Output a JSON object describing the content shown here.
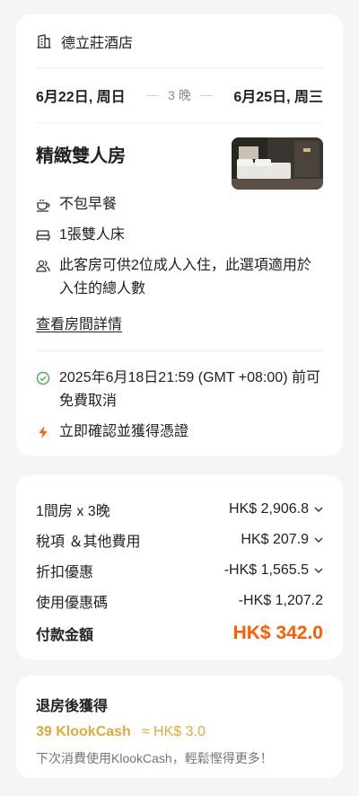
{
  "hotel": {
    "name": "德立莊酒店",
    "icon": "hotel-building-icon"
  },
  "stay": {
    "checkin": "6月22日, 周日",
    "nights": "3 晚",
    "checkout": "6月25日, 周三"
  },
  "room": {
    "name": "精緻雙人房",
    "features": [
      {
        "icon": "breakfast-cup-icon",
        "text": "不包早餐"
      },
      {
        "icon": "bed-icon",
        "text": "1張雙人床"
      },
      {
        "icon": "guests-icon",
        "text": "此客房可供2位成人入住，此選項適用於入住的總人數"
      }
    ],
    "details_link": "查看房間詳情"
  },
  "policies": [
    {
      "icon": "check-circle-icon",
      "color": "#4caf50",
      "text": "2025年6月18日21:59 (GMT +08:00) 前可免費取消"
    },
    {
      "icon": "lightning-icon",
      "color": "#ff5b00",
      "text": "立即確認並獲得憑證"
    }
  ],
  "price": {
    "rows": [
      {
        "label": "1間房 x 3晚",
        "value": "HK$ 2,906.8",
        "expandable": true
      },
      {
        "label": "稅項 ＆其他費用",
        "value": "HK$ 207.9",
        "expandable": true
      },
      {
        "label": "折扣優惠",
        "value": "-HK$ 1,565.5",
        "expandable": true
      },
      {
        "label": "使用優惠碼",
        "value": "-HK$ 1,207.2",
        "expandable": false
      }
    ],
    "total_label": "付款金額",
    "total_value": "HK$ 342.0",
    "accent": "#ff5b00"
  },
  "klookcash": {
    "title": "退房後獲得",
    "amount": "39 KlookCash",
    "equiv": "≈ HK$ 3.0",
    "note": "下次消費使用KlookCash，輕鬆慳得更多！",
    "accent": "#e2a83a"
  }
}
